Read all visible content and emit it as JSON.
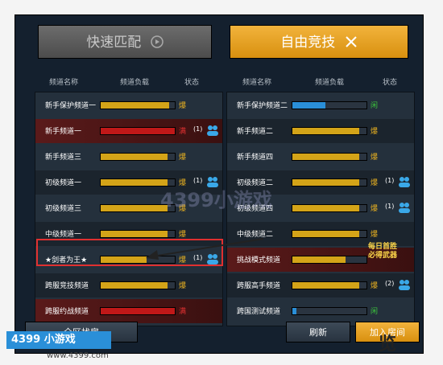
{
  "tabs": {
    "quick": "快速匹配",
    "free": "自由竞技"
  },
  "headers": {
    "name": "频道名称",
    "load": "频道负载",
    "status": "状态"
  },
  "left": [
    {
      "name": "新手保护频道一",
      "fill": 0.92,
      "color": "#d4a418",
      "status": "爆",
      "status_color": "#e8b020",
      "count": "",
      "friend": false
    },
    {
      "name": "新手频道一",
      "fill": 1.0,
      "color": "#c01818",
      "status": "满",
      "status_color": "#e03030",
      "count": "(1)",
      "friend": true
    },
    {
      "name": "新手频道三",
      "fill": 0.9,
      "color": "#d4a418",
      "status": "爆",
      "status_color": "#e8b020",
      "count": "",
      "friend": false
    },
    {
      "name": "初级频道一",
      "fill": 0.9,
      "color": "#d4a418",
      "status": "爆",
      "status_color": "#e8b020",
      "count": "(1)",
      "friend": true
    },
    {
      "name": "初级频道三",
      "fill": 0.9,
      "color": "#d4a418",
      "status": "爆",
      "status_color": "#e8b020",
      "count": "",
      "friend": false
    },
    {
      "name": "中级频道一",
      "fill": 0.9,
      "color": "#d4a418",
      "status": "爆",
      "status_color": "#e8b020",
      "count": "",
      "friend": false
    },
    {
      "name": "★剑者为王★",
      "fill": 0.62,
      "color": "#d4a418",
      "status": "爆",
      "status_color": "#e8b020",
      "count": "(1)",
      "friend": true
    },
    {
      "name": "跨服竞技频道",
      "fill": 0.9,
      "color": "#d4a418",
      "status": "爆",
      "status_color": "#e8b020",
      "count": "",
      "friend": false
    },
    {
      "name": "跨服约战频道",
      "fill": 1.0,
      "color": "#c01818",
      "status": "满",
      "status_color": "#e03030",
      "count": "",
      "friend": false
    }
  ],
  "right": [
    {
      "name": "新手保护频道二",
      "fill": 0.45,
      "color": "#2a8fd8",
      "status": "闲",
      "status_color": "#3cc83c",
      "count": "",
      "friend": false
    },
    {
      "name": "新手频道二",
      "fill": 0.9,
      "color": "#d4a418",
      "status": "爆",
      "status_color": "#e8b020",
      "count": "",
      "friend": false
    },
    {
      "name": "新手频道四",
      "fill": 0.9,
      "color": "#d4a418",
      "status": "爆",
      "status_color": "#e8b020",
      "count": "",
      "friend": false
    },
    {
      "name": "初级频道二",
      "fill": 0.9,
      "color": "#d4a418",
      "status": "爆",
      "status_color": "#e8b020",
      "count": "(1)",
      "friend": true
    },
    {
      "name": "初级频道四",
      "fill": 0.9,
      "color": "#d4a418",
      "status": "爆",
      "status_color": "#e8b020",
      "count": "(1)",
      "friend": true
    },
    {
      "name": "中级频道二",
      "fill": 0.9,
      "color": "#d4a418",
      "status": "爆",
      "status_color": "#e8b020",
      "count": "",
      "friend": false
    },
    {
      "name": "挑战模式频道",
      "fill": 0.72,
      "color": "#d4a418",
      "status": "",
      "status_color": "#e8b020",
      "count": "",
      "friend": false
    },
    {
      "name": "跨服高手频道",
      "fill": 0.9,
      "color": "#d4a418",
      "status": "爆",
      "status_color": "#e8b020",
      "count": "(2)",
      "friend": true
    },
    {
      "name": "跨国测试频道",
      "fill": 0.05,
      "color": "#2a8fd8",
      "status": "闲",
      "status_color": "#3cc83c",
      "count": "",
      "friend": false
    }
  ],
  "badge": {
    "line1": "每日首胜",
    "line2": "必得武器"
  },
  "buttons": {
    "find": "全区找房",
    "refresh": "刷新",
    "join": "加入房间"
  },
  "watermark": {
    "logo": "4399 小游戏",
    "site": "www.4399.com",
    "text": "4399小游戏",
    "corner": "览"
  }
}
